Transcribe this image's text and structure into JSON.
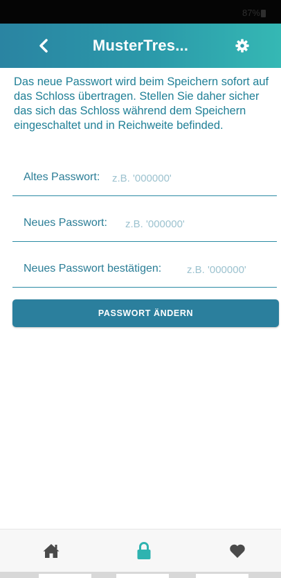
{
  "status_bar": {
    "battery": "87%"
  },
  "header": {
    "title": "MusterTres...",
    "back_icon": "chevron-left-icon",
    "settings_icon": "gear-icon"
  },
  "info_text": "Das neue Passwort wird beim Speichern sofort auf das Schloss übertragen. Stellen Sie daher sicher das sich das Schloss während dem Speichern eingeschaltet und in Reichweite befinded.",
  "form": {
    "old_password": {
      "label": "Altes Passwort:",
      "placeholder": "z.B. '000000'",
      "value": ""
    },
    "new_password": {
      "label": "Neues Passwort:",
      "placeholder": "z.B. '000000'",
      "value": ""
    },
    "confirm_password": {
      "label": "Neues Passwort bestätigen:",
      "placeholder": "z.B. '000000'",
      "value": ""
    },
    "submit_label": "PASSWORT ÄNDERN"
  },
  "bottom_nav": {
    "items": [
      {
        "icon": "home-icon",
        "active": false
      },
      {
        "icon": "lock-icon",
        "active": true
      },
      {
        "icon": "heart-icon",
        "active": false
      }
    ]
  },
  "colors": {
    "header_start": "#2a84a2",
    "header_end": "#35b8b4",
    "accent": "#2b7f9d",
    "text": "#1f7f96",
    "active_nav": "#2fb3b0",
    "inactive_nav": "#4a4a4a"
  }
}
